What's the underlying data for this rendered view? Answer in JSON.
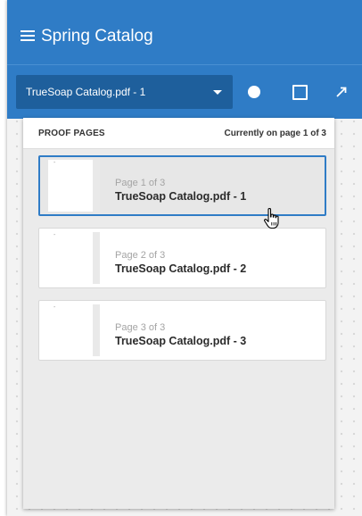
{
  "app": {
    "title": "Spring Catalog",
    "accent_color": "#2f7cc6",
    "toolbar_select_color": "#1e5f9c"
  },
  "toolbar": {
    "document_select_value": "TrueSoap Catalog.pdf - 1",
    "tools": [
      {
        "icon": "circle-tool-icon"
      },
      {
        "icon": "rectangle-tool-icon"
      },
      {
        "icon": "arrow-tool-icon"
      }
    ]
  },
  "proof_panel": {
    "title": "PROOF PAGES",
    "status": "Currently on page 1 of 3",
    "pages": [
      {
        "page_label": "Page 1 of 3",
        "name": "TrueSoap Catalog.pdf - 1",
        "selected": true,
        "thumb_mark": "-"
      },
      {
        "page_label": "Page 2 of 3",
        "name": "TrueSoap Catalog.pdf - 2",
        "selected": false,
        "thumb_mark": "-"
      },
      {
        "page_label": "Page 3 of 3",
        "name": "TrueSoap Catalog.pdf - 3",
        "selected": false,
        "thumb_mark": "-"
      }
    ]
  },
  "cursor": {
    "icon": "hand-pointer-icon"
  }
}
